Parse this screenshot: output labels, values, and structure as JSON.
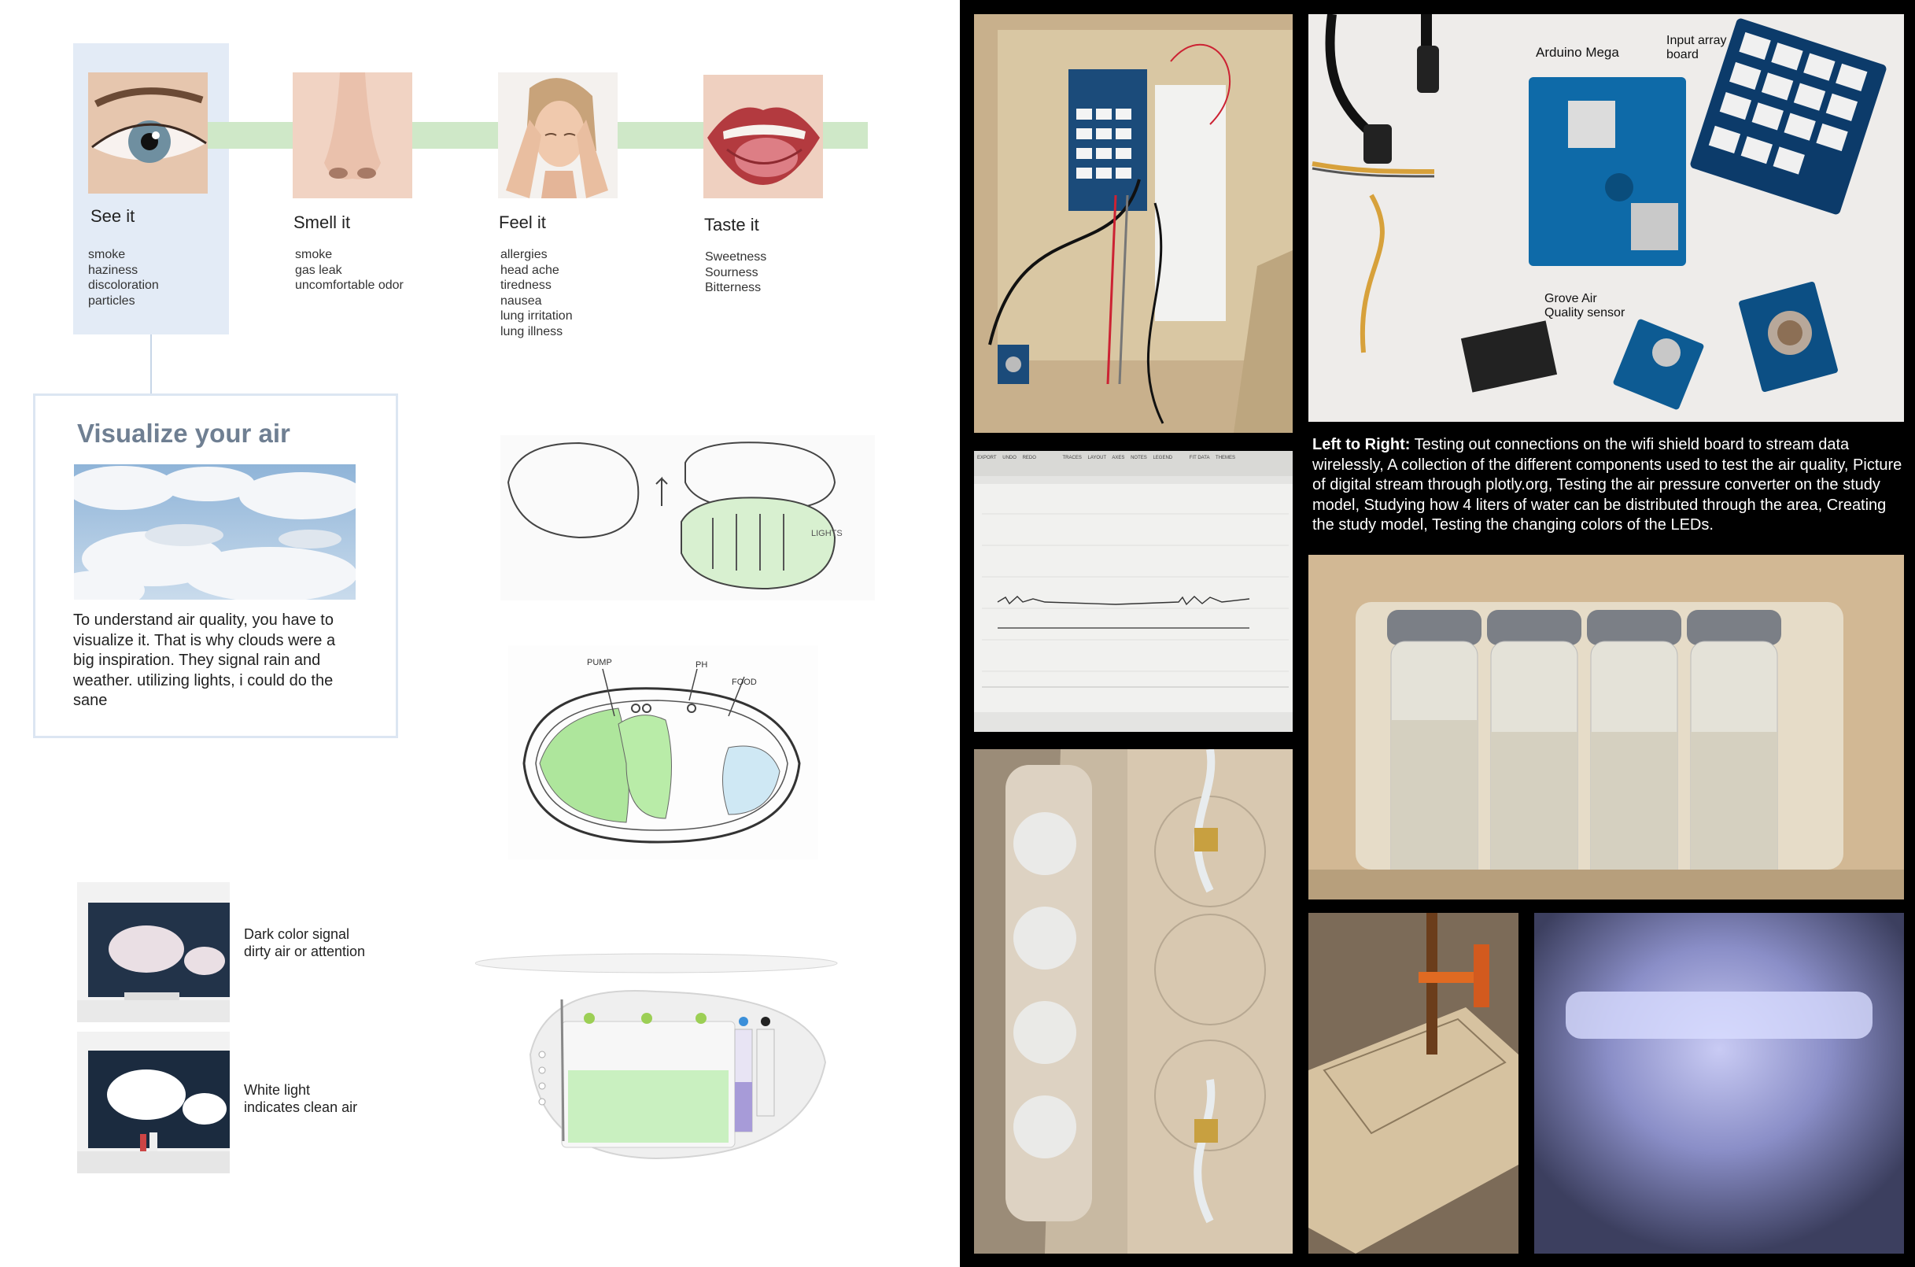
{
  "senses": [
    {
      "title": "See it",
      "items": [
        "smoke",
        "haziness",
        "discoloration",
        "particles"
      ]
    },
    {
      "title": "Smell it",
      "items": [
        "smoke",
        "gas leak",
        "uncomfortable odor"
      ]
    },
    {
      "title": "Feel it",
      "items": [
        "allergies",
        "head ache",
        "tiredness",
        "nausea",
        "lung irritation",
        "lung illness"
      ]
    },
    {
      "title": "Taste it",
      "items": [
        "Sweetness",
        "Sourness",
        "Bitterness"
      ]
    }
  ],
  "visualize": {
    "title": "Visualize your air",
    "text": "To understand air quality, you have to visualize it. That is why clouds were a big inspiration. They signal rain and weather. utilizing lights, i could do the sane"
  },
  "sketch_labels": {
    "lights": "LIGHTS",
    "pump": "PUMP",
    "ph": "PH",
    "food": "FOOD"
  },
  "room_captions": {
    "dark": "Dark color signal dirty air or attention",
    "white": "White light indicates clean air"
  },
  "component_labels": {
    "arduino": "Arduino Mega",
    "input_board": "Input array board",
    "grove": "Grove Air Quality sensor"
  },
  "plotly_toolbar": [
    "EXPORT",
    "UNDO",
    "REDO",
    "TRACES",
    "LAYOUT",
    "AXES",
    "NOTES",
    "LEGEND",
    "FIT DATA",
    "THEMES"
  ],
  "right_caption": {
    "lead": "Left to Right:",
    "text": "Testing out connections on the wifi shield board to stream data wirelessly, A collection of the different components used to test the air quality, Picture of digital stream through plotly.org, Testing the air pressure converter on the study model, Studying how 4 liters of water can be distributed through the area, Creating the study model, Testing the changing colors of the LEDs."
  }
}
